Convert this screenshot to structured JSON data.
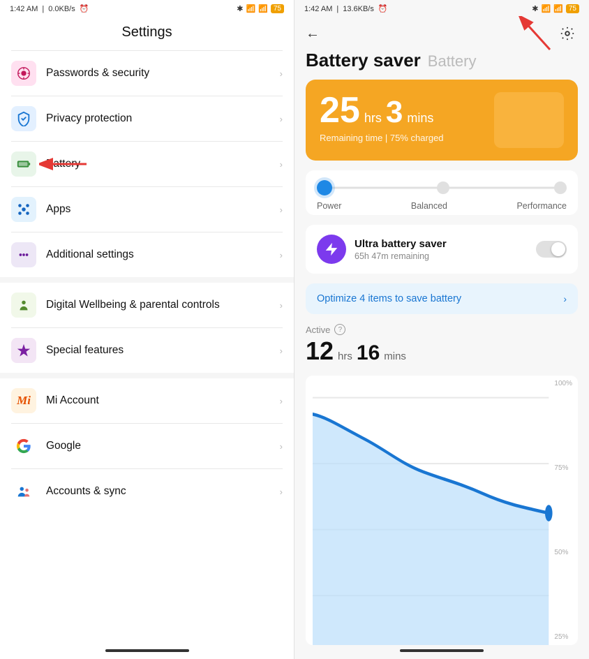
{
  "left": {
    "statusBar": {
      "time": "1:42 AM",
      "data": "0.0KB/s",
      "batteryPercent": "75"
    },
    "title": "Settings",
    "menuItems": [
      {
        "id": "passwords",
        "label": "Passwords & security",
        "iconType": "passwords",
        "iconBg": "#ffe0f0",
        "iconColor": "#c2185b"
      },
      {
        "id": "privacy",
        "label": "Privacy protection",
        "iconType": "privacy",
        "iconBg": "#e3f0ff",
        "iconColor": "#1976d2"
      },
      {
        "id": "battery",
        "label": "Battery",
        "iconType": "battery",
        "iconBg": "#e8f5e9",
        "iconColor": "#388e3c",
        "hasRedArrow": true
      },
      {
        "id": "apps",
        "label": "Apps",
        "iconType": "apps",
        "iconBg": "#e3f2fd",
        "iconColor": "#1565c0"
      },
      {
        "id": "additional",
        "label": "Additional settings",
        "iconType": "additional",
        "iconBg": "#ede7f6",
        "iconColor": "#6a1b9a"
      }
    ],
    "menuItems2": [
      {
        "id": "wellbeing",
        "label": "Digital Wellbeing & parental controls",
        "iconType": "wellbeing",
        "iconBg": "#f1f8e9",
        "iconColor": "#558b2f",
        "twoLine": true
      },
      {
        "id": "special",
        "label": "Special features",
        "iconType": "special",
        "iconBg": "#f3e5f5",
        "iconColor": "#7b1fa2"
      }
    ],
    "menuItems3": [
      {
        "id": "mi",
        "label": "Mi Account",
        "iconType": "mi"
      },
      {
        "id": "google",
        "label": "Google",
        "iconType": "google"
      },
      {
        "id": "accounts",
        "label": "Accounts & sync",
        "iconType": "accounts"
      }
    ]
  },
  "right": {
    "statusBar": {
      "time": "1:42 AM",
      "data": "13.6KB/s",
      "batteryPercent": "75"
    },
    "title": "Battery saver",
    "subtitle": "Battery",
    "batteryCard": {
      "hours": "25",
      "hrsLabel": "hrs",
      "mins": "3",
      "minsLabel": "mins",
      "status": "Remaining time | 75% charged"
    },
    "modeLabels": [
      "Power",
      "Balanced",
      "Performance"
    ],
    "ultraSaver": {
      "title": "Ultra battery saver",
      "subtitle": "65h 47m remaining"
    },
    "optimizeBanner": {
      "text": "Optimize 4 items to save battery"
    },
    "active": {
      "label": "Active",
      "hours": "12",
      "hrsLabel": "hrs",
      "mins": "16",
      "minsLabel": "mins"
    },
    "chartLabels": [
      "100%",
      "75%",
      "50%",
      "25%"
    ]
  }
}
